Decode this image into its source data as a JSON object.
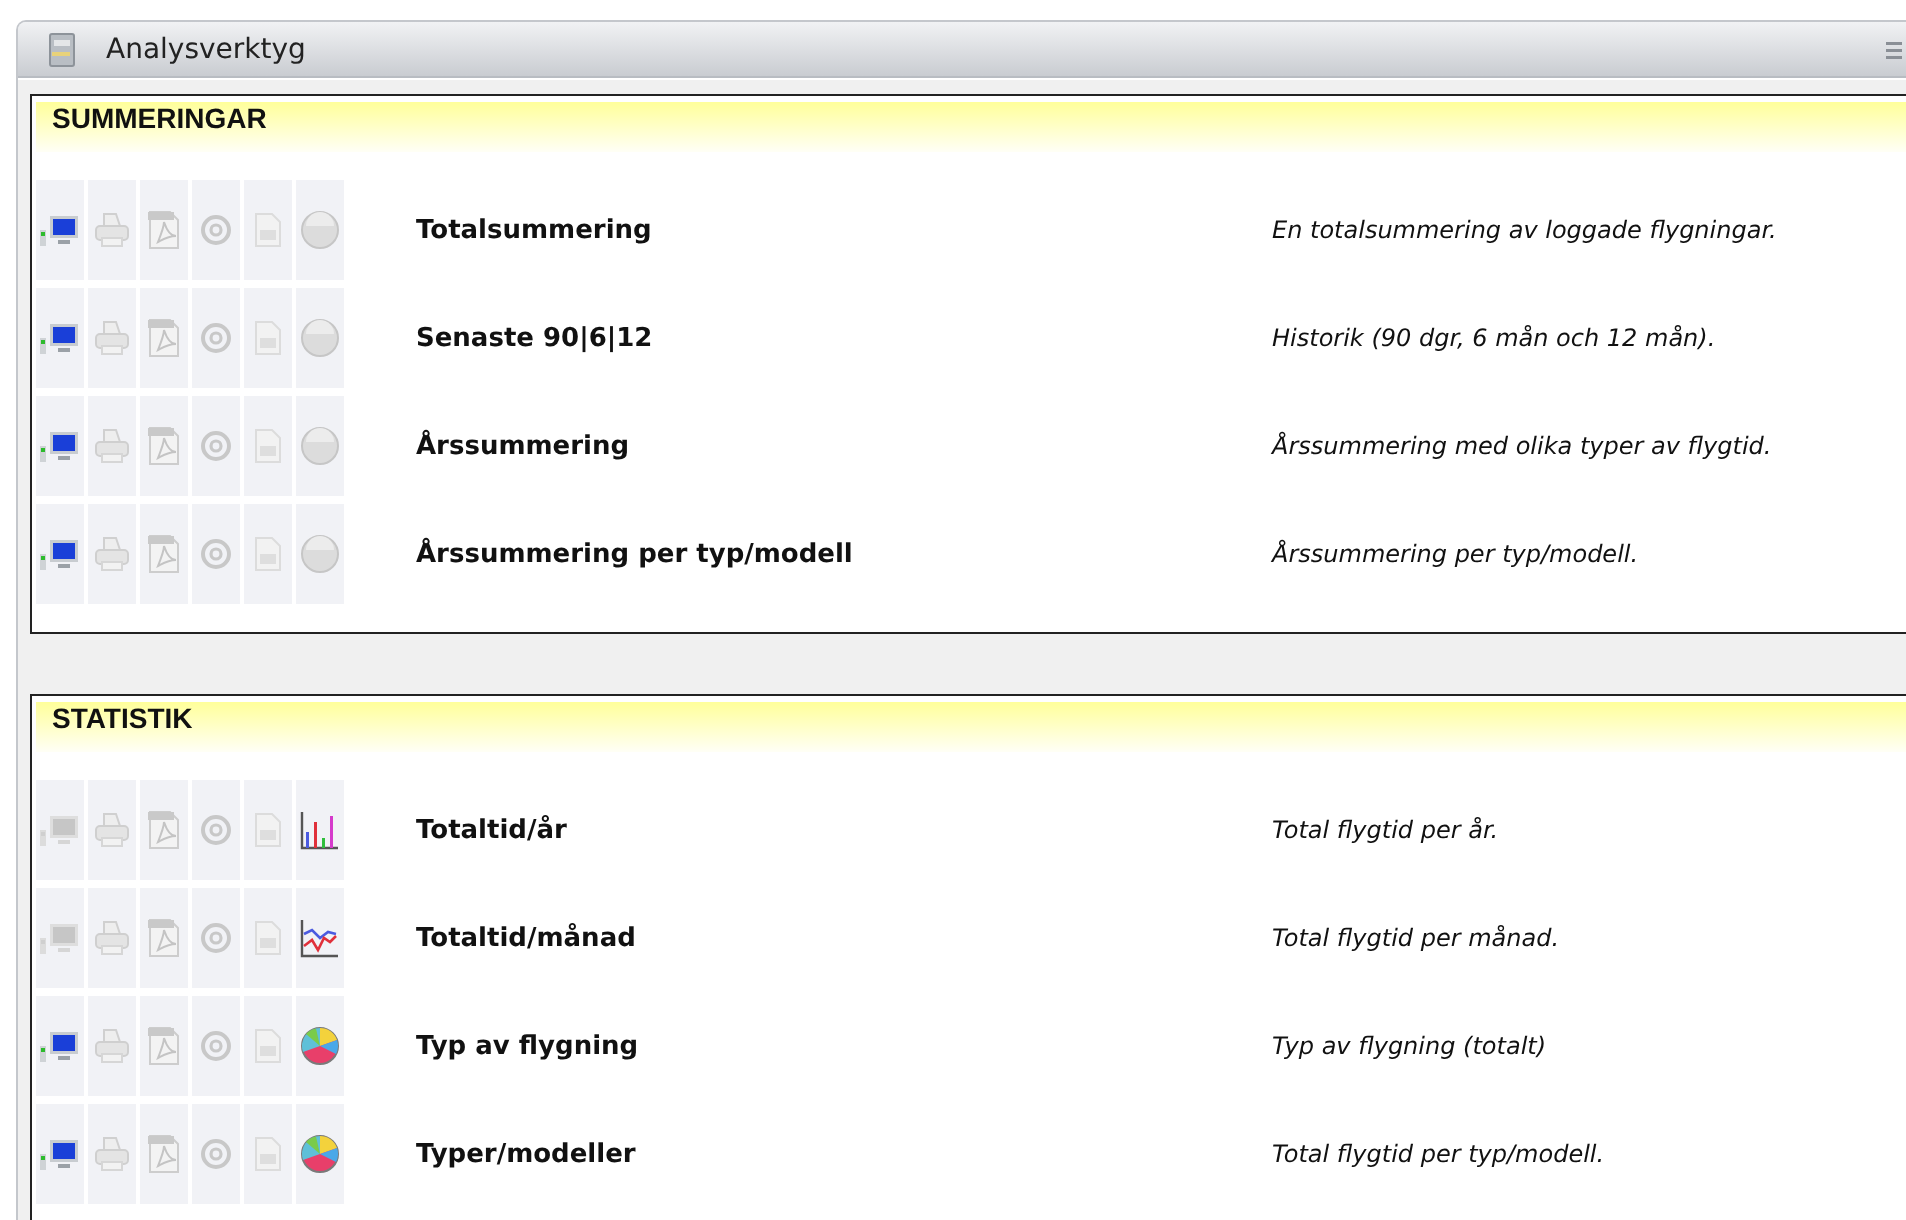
{
  "window": {
    "title": "Analysverktyg"
  },
  "sections": [
    {
      "title": "SUMMERINGAR",
      "rows": [
        {
          "name": "Totalsummering",
          "description": "En totalsummering av loggade flygningar.",
          "screen_enabled": true,
          "kind": "disc"
        },
        {
          "name": "Senaste 90|6|12",
          "description": "Historik (90 dgr, 6 mån och 12 mån).",
          "screen_enabled": true,
          "kind": "disc"
        },
        {
          "name": "Årssummering",
          "description": "Årssummering med olika typer av flygtid.",
          "screen_enabled": true,
          "kind": "disc"
        },
        {
          "name": "Årssummering per typ/modell",
          "description": "Årssummering per typ/modell.",
          "screen_enabled": true,
          "kind": "disc"
        }
      ]
    },
    {
      "title": "STATISTIK",
      "rows": [
        {
          "name": "Totaltid/år",
          "description": "Total flygtid per år.",
          "screen_enabled": false,
          "kind": "bar"
        },
        {
          "name": "Totaltid/månad",
          "description": "Total flygtid per månad.",
          "screen_enabled": false,
          "kind": "line"
        },
        {
          "name": "Typ av flygning",
          "description": "Typ av flygning (totalt)",
          "screen_enabled": true,
          "kind": "pie"
        },
        {
          "name": "Typer/modeller",
          "description": "Total flygtid per typ/modell.",
          "screen_enabled": true,
          "kind": "pie"
        }
      ]
    }
  ]
}
